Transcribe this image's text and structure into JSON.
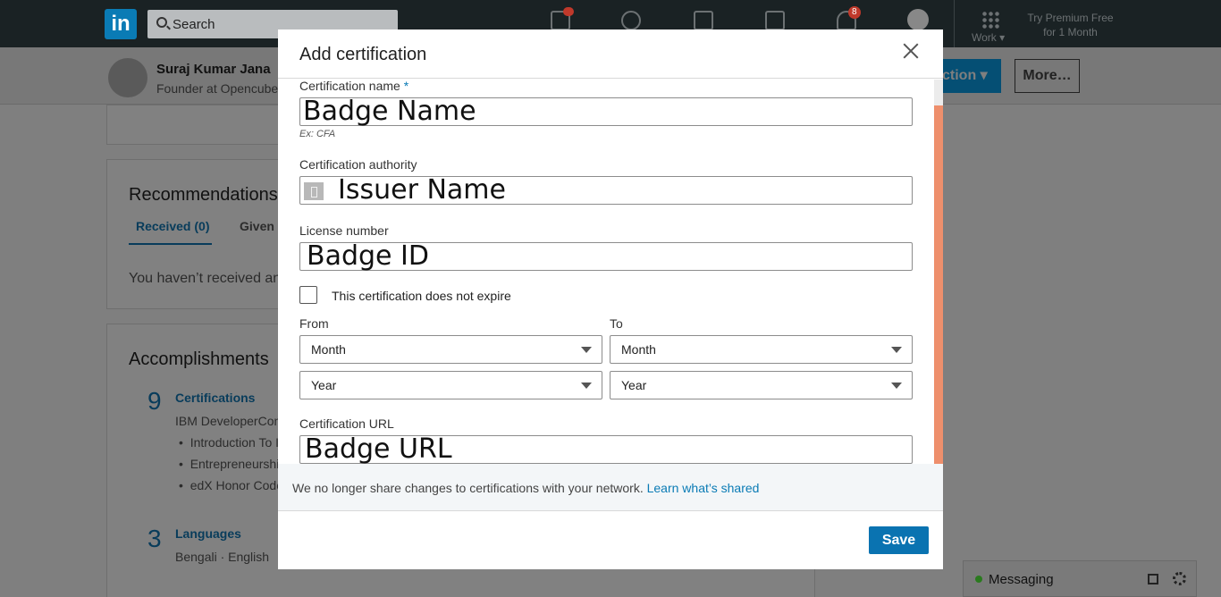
{
  "nav": {
    "logo": "in",
    "search_placeholder": "Search",
    "notif_badge": "8",
    "work_label": "Work ▾",
    "premium_line1": "Try Premium Free",
    "premium_line2": "for 1 Month"
  },
  "profile": {
    "name": "Suraj Kumar Jana",
    "title": "Founder at Opencube",
    "section_button": "ction ▾",
    "more_button": "More…"
  },
  "recommendations": {
    "title": "Recommendations",
    "tab_received": "Received (0)",
    "tab_given": "Given (",
    "empty_text": "You haven’t received an"
  },
  "accomplishments": {
    "title": "Accomplishments",
    "cert_count": "9",
    "cert_title": "Certifications",
    "cert_sub": "IBM DeveloperCon",
    "cert_items": [
      "Introduction To I",
      "Entrepreneurshi",
      "edX Honor Code"
    ],
    "lang_count": "3",
    "lang_title": "Languages",
    "lang_items": "Bengali  ·  English"
  },
  "modal": {
    "title": "Add certification",
    "cert_name_label": "Certification name",
    "required_mark": "*",
    "cert_name_value": "Badge Name",
    "cert_name_hint": "Ex: CFA",
    "authority_label": "Certification authority",
    "authority_value": "Issuer Name",
    "license_label": "License number",
    "license_value": "Badge ID",
    "no_expire_label": "This certification does not expire",
    "from_label": "From",
    "to_label": "To",
    "from_month": "Month",
    "from_year": "Year",
    "to_month": "Month",
    "to_year": "Year",
    "url_label": "Certification URL",
    "url_value": "Badge URL",
    "notice_text": "We no longer share changes to certifications with your network.",
    "notice_link": "Learn what’s shared",
    "save_label": "Save"
  },
  "messaging": {
    "label": "Messaging"
  }
}
